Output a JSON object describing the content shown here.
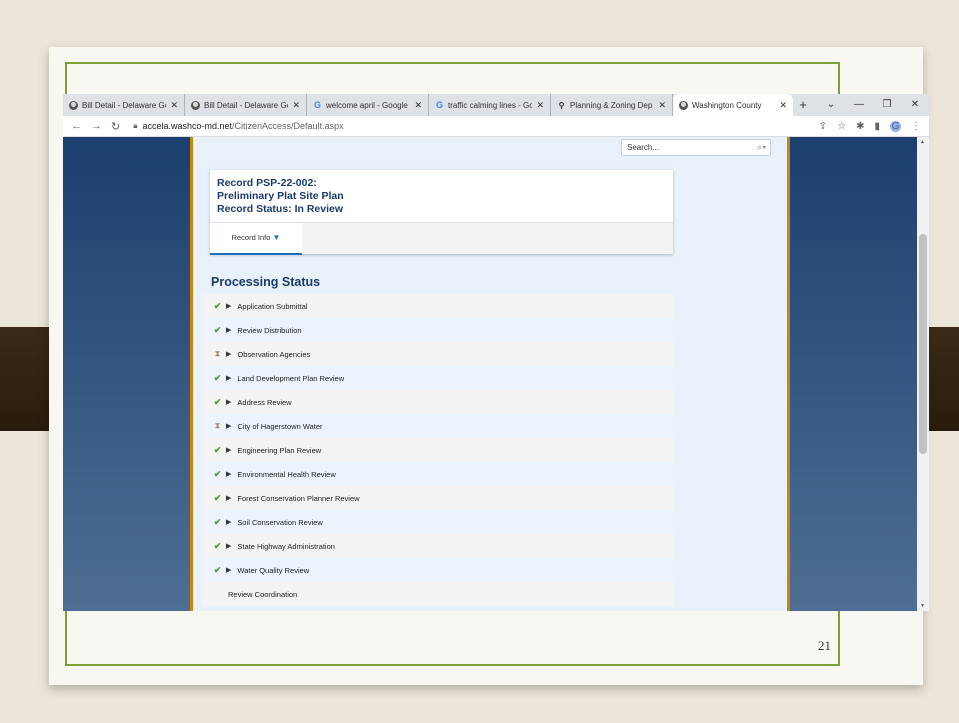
{
  "browser": {
    "tabs": [
      {
        "icon": "globe-icon",
        "title": "Bill Detail - Delaware Ge",
        "active": false
      },
      {
        "icon": "globe-icon",
        "title": "Bill Detail - Delaware Ge",
        "active": false
      },
      {
        "icon": "google-icon",
        "title": "welcome april - Google",
        "active": false
      },
      {
        "icon": "google-icon",
        "title": "traffic calming lines - Go",
        "active": false
      },
      {
        "icon": "pin-icon",
        "title": "Planning & Zoning Dep",
        "active": false
      },
      {
        "icon": "globe-icon",
        "title": "Washington County",
        "active": true
      }
    ],
    "close_glyph": "✕",
    "new_tab": "+",
    "address": {
      "domain": "accela.washco-md.net",
      "path": "/CitizenAccess/Default.aspx"
    }
  },
  "page": {
    "search_placeholder": "Search...",
    "record": {
      "line1": "Record PSP-22-002:",
      "line2": "Preliminary Plat Site Plan",
      "line3": "Record Status: In Review"
    },
    "record_tab": {
      "label": "Record Info"
    },
    "processing_heading": "Processing Status",
    "processing_items": [
      {
        "label": "Application Submittal",
        "status": "complete"
      },
      {
        "label": "Review Distribution",
        "status": "complete"
      },
      {
        "label": "Observation Agencies",
        "status": "pending"
      },
      {
        "label": "Land Development Plan Review",
        "status": "complete"
      },
      {
        "label": "Address Review",
        "status": "complete"
      },
      {
        "label": "City of Hagerstown Water",
        "status": "pending"
      },
      {
        "label": "Engineering Plan Review",
        "status": "complete"
      },
      {
        "label": "Environmental Health Review",
        "status": "complete"
      },
      {
        "label": "Forest Conservation Planner Review",
        "status": "complete"
      },
      {
        "label": "Soil Conservation Review",
        "status": "complete"
      },
      {
        "label": "State Highway Administration",
        "status": "complete"
      },
      {
        "label": "Water Quality Review",
        "status": "complete"
      },
      {
        "label": "Review Coordination",
        "status": "none"
      }
    ]
  },
  "slide": {
    "number": "21"
  },
  "colors": {
    "accent_green": "#7f9e38",
    "sidebar_blue": "#1b3f6e",
    "heading_blue": "#1a3b6b",
    "check_green": "#4a9e2f",
    "gold_border": "#c8860a"
  }
}
